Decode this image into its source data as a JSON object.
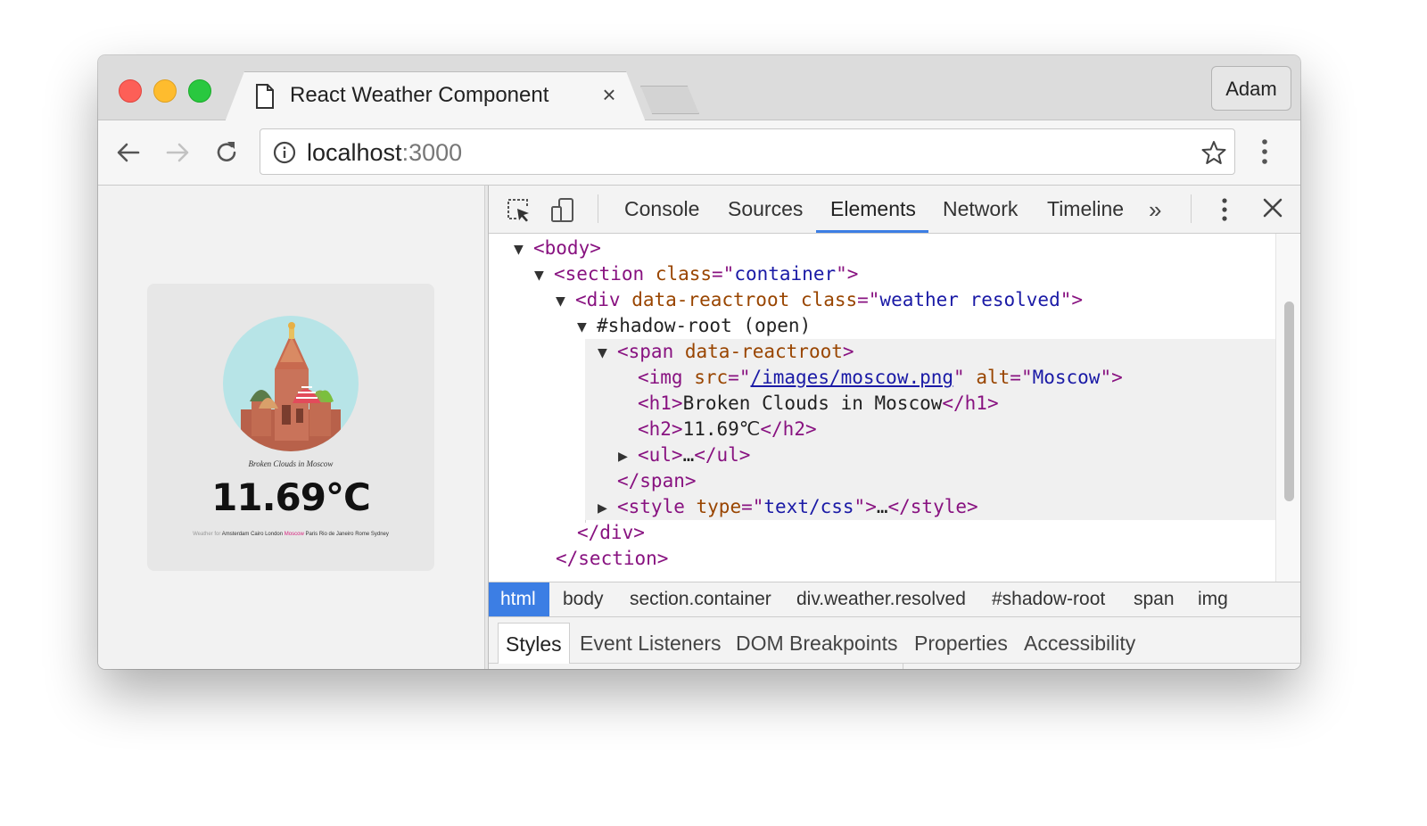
{
  "browser": {
    "tab_title": "React Weather Component",
    "tab_close": "×",
    "profile_name": "Adam",
    "url_host": "localhost",
    "url_port": ":3000"
  },
  "weather": {
    "caption": "Broken Clouds in Moscow",
    "temperature": "11.69°C",
    "cities_label": "Weather for",
    "cities": [
      "Amsterdam",
      "Cairo",
      "London",
      "Moscow",
      "Paris",
      "Rio de Janeiro",
      "Rome",
      "Sydney"
    ],
    "active_city": "Moscow",
    "colors": {
      "circle": "#b7e4e7",
      "active_city": "#d6207c"
    }
  },
  "devtools": {
    "tabs": [
      "Console",
      "Sources",
      "Elements",
      "Network",
      "Timeline"
    ],
    "active_tab": "Elements",
    "more_tabs": "»",
    "dom": {
      "body_tag": "<body>",
      "section_open": "<section",
      "section_class_attr": "class",
      "section_class_val": "container",
      "div_open": "<div",
      "div_attr1": "data-reactroot",
      "div_class_attr": "class",
      "div_class_val": "weather resolved",
      "shadow_root": "#shadow-root (open)",
      "span_open": "<span",
      "span_attr": "data-reactroot",
      "img_open": "<img",
      "img_src_attr": "src",
      "img_src_val": "/images/moscow.png",
      "img_alt_attr": "alt",
      "img_alt_val": "Moscow",
      "h1_open": "<h1>",
      "h1_text": "Broken Clouds in Moscow",
      "h1_close": "</h1>",
      "h2_open": "<h2>",
      "h2_text": "11.69℃",
      "h2_close": "</h2>",
      "ul_open": "<ul>",
      "ul_ellipsis": "…",
      "ul_close": "</ul>",
      "span_close": "</span>",
      "style_open": "<style",
      "style_type_attr": "type",
      "style_type_val": "text/css",
      "style_ellipsis": "…",
      "style_close": "</style>",
      "div_close": "</div>",
      "section_close": "</section>"
    },
    "breadcrumbs": [
      "html",
      "body",
      "section.container",
      "div.weather.resolved",
      "#shadow-root",
      "span",
      "img"
    ],
    "active_breadcrumb": "html",
    "subtabs": [
      "Styles",
      "Event Listeners",
      "DOM Breakpoints",
      "Properties",
      "Accessibility"
    ],
    "active_subtab": "Styles",
    "colors": {
      "accent": "#3c7ee4",
      "tag": "#881280",
      "attr": "#994500",
      "value": "#1a1aa6"
    }
  }
}
